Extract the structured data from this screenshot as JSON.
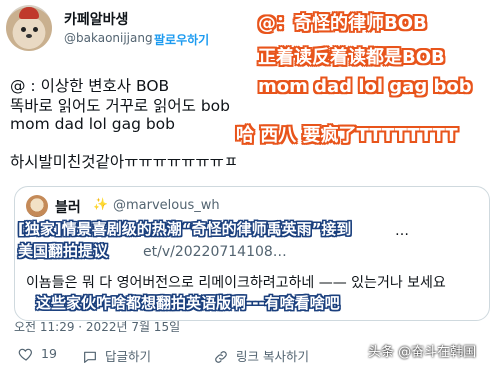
{
  "author": {
    "display_name": "카페알바생",
    "handle": "@bakaonijjang",
    "follow_label": "팔로우하기"
  },
  "tweet": {
    "lines": [
      "@ : 이상한 변호사 BOB",
      "똑바로 읽어도 거꾸로 읽어도 bob",
      "mom dad lol gag bob",
      "하시발미친것같아ㅠㅠㅠㅠㅠㅠㅠㅍ"
    ]
  },
  "overlay_captions": [
    "@：奇怪的律师BOB",
    "正着读反着读都是BOB",
    "mom dad lol gag bob",
    "哈 西八 要疯了TTTTTTTT"
  ],
  "quote": {
    "name": "블러",
    "badge": "✨",
    "handle": "@marvelous_wh",
    "line1": "…",
    "line2": "et/v/20220714108…",
    "line3": "이뇸들은 뭐 다 영어버전으로 리메이크하려고하네 —— 있는거나 보세요"
  },
  "subtitle_captions": [
    "[独家]情景喜剧级的热潮“奇怪的律师禹英雨”接到",
    "美国翻拍提议",
    "这些家伙咋啥都想翻拍英语版啊---有啥看啥吧"
  ],
  "timestamp": "오전 11:29 · 2022년 7월 15일",
  "actions": {
    "likes": "19",
    "reply": "답글하기",
    "share": "링크 복사하기"
  },
  "watermark": "头条 @奋斗在韩国",
  "colors": {
    "overlay_stroke": "#e8541b",
    "subtitle_stroke": "#1a3f7d",
    "link": "#1d9bf0"
  }
}
